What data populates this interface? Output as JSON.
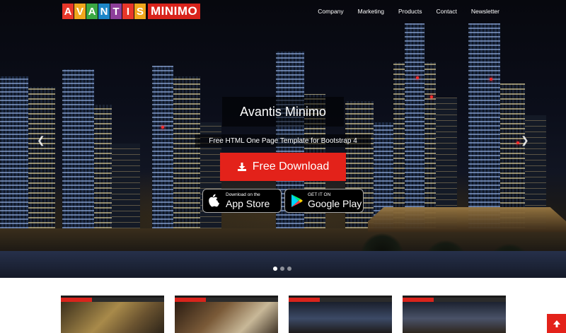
{
  "brand": {
    "letters": [
      "A",
      "V",
      "A",
      "N",
      "T",
      "I",
      "S"
    ],
    "letter_colors": [
      "#e8372a",
      "#f0a71d",
      "#3aa843",
      "#1c86c8",
      "#8d3f9a",
      "#e8372a",
      "#f0a71d"
    ],
    "word2": "MINIMO",
    "word2_color": "#d9241c"
  },
  "nav": {
    "items": [
      "Company",
      "Marketing",
      "Products",
      "Contact",
      "Newsletter"
    ]
  },
  "hero": {
    "title": "Avantis Minimo",
    "subtitle": "Free HTML One Page Template for Bootstrap 4",
    "download_label": "Free Download",
    "app_store": {
      "small": "Download on the",
      "big": "App Store"
    },
    "google_play": {
      "small": "GET IT ON",
      "big": "Google Play"
    },
    "prev_icon": "chevron-left-icon",
    "next_icon": "chevron-right-icon",
    "slides_count": 3,
    "active_slide": 1
  },
  "colors": {
    "accent": "#e3221a"
  },
  "back_to_top_icon": "arrow-up-icon"
}
